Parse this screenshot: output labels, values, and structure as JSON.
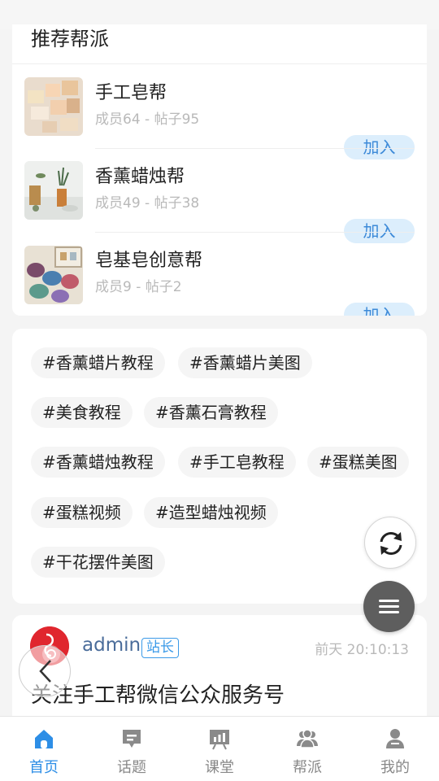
{
  "groups_section": {
    "title": "推荐帮派",
    "join_label": "加入",
    "items": [
      {
        "name": "手工皂帮",
        "meta": "成员64 - 帖子95"
      },
      {
        "name": "香薰蜡烛帮",
        "meta": "成员49 - 帖子38"
      },
      {
        "name": "皂基皂创意帮",
        "meta": "成员9 - 帖子2"
      }
    ]
  },
  "tags": [
    "#香薰蜡片教程",
    "#香薰蜡片美图",
    "#美食教程",
    "#香薰石膏教程",
    "#香薰蜡烛教程",
    "#手工皂教程",
    "#蛋糕美图",
    "#蛋糕视频",
    "#造型蜡烛视频",
    "#干花摆件美图"
  ],
  "post": {
    "author": "admin",
    "role_badge": "站长",
    "time": "前天 20:10:13",
    "title": "关注手工帮微信公众服务号"
  },
  "fab": {
    "refresh_icon": "refresh-icon",
    "menu_icon": "menu-icon",
    "back_icon": "chevron-left-icon"
  },
  "tabbar": [
    {
      "label": "首页",
      "icon": "home-icon",
      "active": true
    },
    {
      "label": "话题",
      "icon": "chat-icon",
      "active": false
    },
    {
      "label": "课堂",
      "icon": "classroom-icon",
      "active": false
    },
    {
      "label": "帮派",
      "icon": "group-icon",
      "active": false
    },
    {
      "label": "我的",
      "icon": "user-icon",
      "active": false
    }
  ],
  "colors": {
    "accent": "#2d8ee6",
    "join_bg": "#dceefc",
    "inactive": "#888888",
    "badge": "#3b9ae8"
  }
}
